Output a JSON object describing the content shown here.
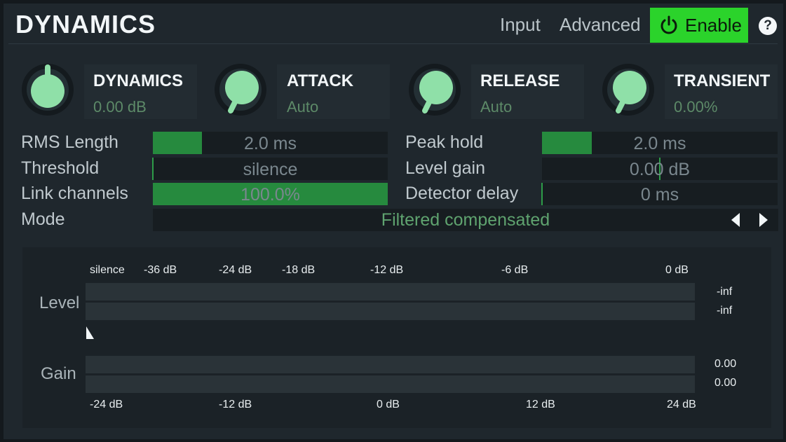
{
  "header": {
    "title": "DYNAMICS",
    "input_label": "Input",
    "advanced_label": "Advanced",
    "enable_label": "Enable",
    "help_label": "?"
  },
  "knobs": [
    {
      "name": "DYNAMICS",
      "value": "0.00 dB"
    },
    {
      "name": "ATTACK",
      "value": "Auto"
    },
    {
      "name": "RELEASE",
      "value": "Auto"
    },
    {
      "name": "TRANSIENT",
      "value": "0.00%"
    }
  ],
  "params": {
    "rms_length": {
      "label": "RMS Length",
      "value": "2.0 ms",
      "fill": 0.21
    },
    "threshold": {
      "label": "Threshold",
      "value": "silence",
      "fill": 0.0
    },
    "link_channels": {
      "label": "Link channels",
      "value": "100.0%",
      "fill": 1.0
    },
    "peak_hold": {
      "label": "Peak hold",
      "value": "2.0 ms",
      "fill": 0.21
    },
    "level_gain": {
      "label": "Level gain",
      "value": "0.00 dB",
      "fill": 0.5
    },
    "detector_delay": {
      "label": "Detector delay",
      "value": "0 ms",
      "fill": 0.0
    },
    "mode": {
      "label": "Mode",
      "value": "Filtered compensated"
    }
  },
  "meter": {
    "level_label": "Level",
    "gain_label": "Gain",
    "level_ticks": [
      "silence",
      "-36 dB",
      "-24 dB",
      "-18 dB",
      "-12 dB",
      "-6 dB",
      "0 dB"
    ],
    "gain_ticks": [
      "-24 dB",
      "-12 dB",
      "0 dB",
      "12 dB",
      "24 dB"
    ],
    "level_readouts": [
      "-inf",
      "-inf"
    ],
    "gain_readouts": [
      "0.00",
      "0.00"
    ]
  },
  "colors": {
    "accent": "#2bd32b",
    "knob": "#8fe0a8",
    "slider_fill": "#268a3e"
  },
  "icons": [
    "power-icon",
    "help-icon",
    "arrow-left-icon",
    "arrow-right-icon",
    "threshold-pointer-icon"
  ]
}
